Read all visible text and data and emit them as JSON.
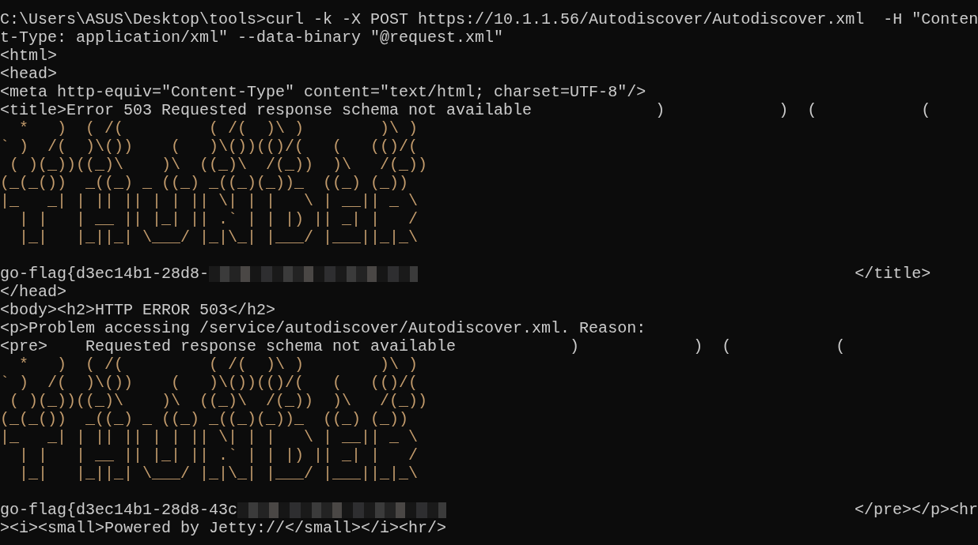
{
  "terminal": {
    "lines": [
      {
        "kind": "text",
        "text": "C:\\Users\\ASUS\\Desktop\\tools>curl -k -X POST https://10.1.1.56/Autodiscover/Autodiscover.xml  -H \"Conten"
      },
      {
        "kind": "text",
        "text": "t-Type: application/xml\" --data-binary \"@request.xml\""
      },
      {
        "kind": "text",
        "text": "<html>"
      },
      {
        "kind": "text",
        "text": "<head>"
      },
      {
        "kind": "text",
        "text": "<meta http-equiv=\"Content-Type\" content=\"text/html; charset=UTF-8\"/>"
      },
      {
        "kind": "text",
        "text": "<title>Error 503 Requested response schema not available             )            )  (           ("
      },
      {
        "kind": "art",
        "text": "  *   )  ( /(         ( /(  )\\ )        )\\ )"
      },
      {
        "kind": "art",
        "text": "` )  /(  )\\())    (   )\\())(()/(   (   (()/("
      },
      {
        "kind": "art",
        "text": " ( )(_))((_)\\    )\\  ((_)\\  /(_))  )\\   /(_))"
      },
      {
        "kind": "art",
        "text": "(_(_())  _((_) _ ((_) _((_)(_))_  ((_) (_))"
      },
      {
        "kind": "art",
        "text": "|_   _| | || || | | || \\| | |   \\ | __|| _ \\"
      },
      {
        "kind": "art",
        "text": "  | |   | __ || |_| || .` | | |) || _| |   /"
      },
      {
        "kind": "art",
        "text": "  |_|   |_||_| \\___/ |_|\\_| |___/ |___||_|_\\"
      },
      {
        "kind": "blank"
      },
      {
        "kind": "mixed",
        "segments": [
          {
            "kind": "text",
            "text": "go-flag{d3ec14b1-28d8-"
          },
          {
            "kind": "redacted"
          },
          {
            "kind": "tail",
            "text": "</title>"
          }
        ]
      },
      {
        "kind": "text",
        "text": "</head>"
      },
      {
        "kind": "text",
        "text": "<body><h2>HTTP ERROR 503</h2>"
      },
      {
        "kind": "text",
        "text": "<p>Problem accessing /service/autodiscover/Autodiscover.xml. Reason:"
      },
      {
        "kind": "text",
        "text": "<pre>    Requested response schema not available            )            )  (           ("
      },
      {
        "kind": "art",
        "text": "  *   )  ( /(         ( /(  )\\ )        )\\ )"
      },
      {
        "kind": "art",
        "text": "` )  /(  )\\())    (   )\\())(()/(   (   (()/("
      },
      {
        "kind": "art",
        "text": " ( )(_))((_)\\    )\\  ((_)\\  /(_))  )\\   /(_))"
      },
      {
        "kind": "art",
        "text": "(_(_())  _((_) _ ((_) _((_)(_))_  ((_) (_))"
      },
      {
        "kind": "art",
        "text": "|_   _| | || || | | || \\| | |   \\ | __|| _ \\"
      },
      {
        "kind": "art",
        "text": "  | |   | __ || |_| || .` | | |) || _| |   /"
      },
      {
        "kind": "art",
        "text": "  |_|   |_||_| \\___/ |_|\\_| |___/ |___||_|_\\"
      },
      {
        "kind": "blank"
      },
      {
        "kind": "mixed",
        "segments": [
          {
            "kind": "text",
            "text": "go-flag{d3ec14b1-28d8-43c"
          },
          {
            "kind": "redacted"
          },
          {
            "kind": "tail",
            "text": "</pre></p><hr"
          }
        ]
      },
      {
        "kind": "text",
        "text": "><i><small>Powered by Jetty://</small></i><hr/>"
      }
    ]
  }
}
